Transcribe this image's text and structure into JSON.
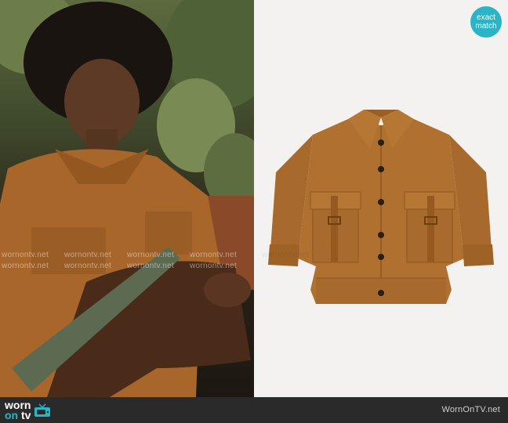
{
  "badge": {
    "line1": "exact",
    "line2": "match"
  },
  "footer": {
    "logo_prefix": "worn",
    "logo_on": "on",
    "logo_suffix": "tv",
    "site_credit": "WornOnTV.net"
  },
  "watermark_text": "wornontv.net",
  "colors": {
    "jacket": "#b0702f",
    "accent_teal": "#2bb3c6",
    "footer_bg": "#2a2a2a"
  },
  "icons": [
    "tv-icon"
  ]
}
